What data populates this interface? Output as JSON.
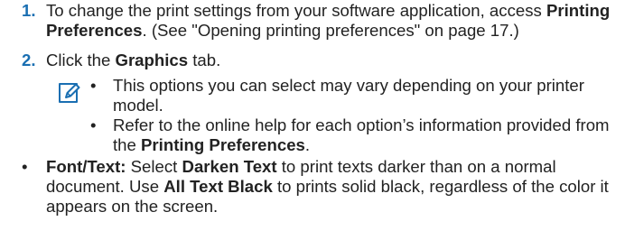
{
  "step1": {
    "number": "1.",
    "text_a": "To change the print settings from your software application, access",
    "bold_a": "Printing Preferences",
    "text_b": ". (See \"Opening printing preferences\" on page 17.)"
  },
  "step2": {
    "number": "2.",
    "text_a": "Click the",
    "bold_a": "Graphics",
    "text_b": "tab."
  },
  "note": {
    "icon": "pencil-note-icon",
    "bullets": [
      {
        "text": "This options you can select may vary depending on your printer model."
      },
      {
        "text_a": "Refer to the online help for each option’s information provided from the",
        "bold_a": "Printing Preferences",
        "text_b": "."
      }
    ]
  },
  "font_text": {
    "label": "Font/Text:",
    "text_a": "Select",
    "bold_a": "Darken Text",
    "text_b": "to print texts darker than on a normal document. Use",
    "bold_b": "All Text Black",
    "text_c": "to prints solid black, regardless of the color it appears on the screen."
  },
  "bullet_char": "•",
  "colors": {
    "step_number": "#1a6fb2",
    "text": "#222222",
    "icon_stroke": "#1a6fb2"
  }
}
